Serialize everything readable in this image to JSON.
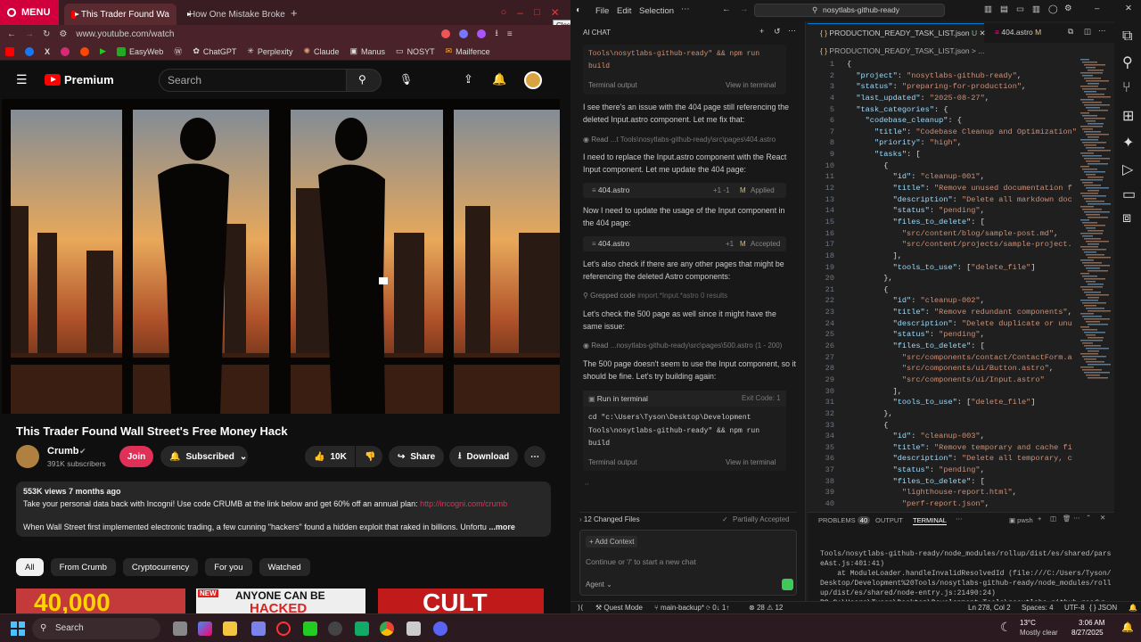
{
  "browser": {
    "menu_label": "MENU",
    "tabs": [
      {
        "label": "This Trader Found Wa"
      },
      {
        "label": "How One Mistake Broke C"
      }
    ],
    "close_tooltip": "Close",
    "url": "www.youtube.com/watch",
    "bookmarks": [
      {
        "label": "EasyWeb"
      },
      {
        "label": "ChatGPT"
      },
      {
        "label": "Perplexity"
      },
      {
        "label": "Claude"
      },
      {
        "label": "Manus"
      },
      {
        "label": "NOSYT"
      },
      {
        "label": "Mailfence"
      }
    ]
  },
  "youtube": {
    "logo": "Premium",
    "search_placeholder": "Search",
    "video_title": "This Trader Found Wall Street's Free Money Hack",
    "channel": "Crumb",
    "subscribers": "391K subscribers",
    "join_label": "Join",
    "subscribed_label": "Subscribed",
    "likes": "10K",
    "share_label": "Share",
    "download_label": "Download",
    "views_line": "553K views  7 months ago",
    "desc_line1": "Take your personal data back with Incogni! Use code CRUMB at the link below and get 60% off an annual plan: ",
    "desc_link": "http://incogni.com/crumb",
    "desc_line2": "When Wall Street first implemented electronic trading, a few cunning \"hackers\" found a hidden exploit that raked in billions. Unfortu",
    "more_label": "...more",
    "chips": [
      "All",
      "From Crumb",
      "Cryptocurrency",
      "For you",
      "Watched"
    ],
    "thumb1_text": "40,000",
    "thumb2_new": "NEW",
    "thumb2_text1": "ANYONE CAN BE",
    "thumb2_text2": "HACKED",
    "thumb3_text": "CULT"
  },
  "vscode": {
    "menu": [
      "File",
      "Edit",
      "Selection"
    ],
    "search_text": "nosytlabs-github-ready",
    "chat_title": "AI CHAT",
    "chat": {
      "cmd_top": "Tools\\nosytlabs-github-ready\" && npm run build",
      "terminal_output": "Terminal output",
      "view_in_terminal": "View in terminal",
      "msg1": "I see there's an issue with the 404 page still referencing the deleted Input.astro component. Let me fix that:",
      "read1": "Read",
      "read1_path": "...t Tools\\nosytlabs-github-ready\\src\\pages\\404.astro",
      "msg2": "I need to replace the Input.astro component with the React Input component. Let me update the 404 page:",
      "file1": "404.astro",
      "file1_diff": "+1 -1",
      "file1_status": "Applied",
      "msg3": "Now I need to update the usage of the Input component in the 404 page:",
      "file2": "404.astro",
      "file2_diff": "+1",
      "file2_status": "Accepted",
      "msg4": "Let's also check if there are any other pages that might be referencing the deleted Astro components:",
      "grep": "Grepped code",
      "grep_detail": "import.*Input.*astro  0 results",
      "msg5": "Let's check the 500 page as well since it might have the same issue:",
      "read2": "Read",
      "read2_path": "...nosytlabs-github-ready\\src\\pages\\500.astro (1 - 200)",
      "msg6": "The 500 page doesn't seem to use the Input component, so it should be fine. Let's try building again:",
      "run_label": "Run in terminal",
      "exit_code": "Exit Code: 1",
      "cmd": "cd \"c:\\Users\\Tyson\\Desktop\\Development Tools\\nosytlabs-github-ready\" && npm run build",
      "dots": "∙∙",
      "changed_files": "12 Changed Files",
      "partially": "Partially Accepted",
      "add_context": "Add Context",
      "input_placeholder": "Continue or '/' to start a new chat",
      "agent_label": "Agent"
    },
    "tabs": [
      {
        "label": "PRODUCTION_READY_TASK_LIST.json",
        "badge": "U"
      },
      {
        "label": "404.astro",
        "badge": "M"
      }
    ],
    "breadcrumb": "PRODUCTION_READY_TASK_LIST.json > ...",
    "code_lines": [
      [
        [
          "pu",
          "{"
        ]
      ],
      [
        [
          "pu",
          "  "
        ],
        [
          "k",
          "\"project\""
        ],
        [
          "pu",
          ": "
        ],
        [
          "s",
          "\"nosytlabs-github-ready\""
        ],
        [
          "pu",
          ","
        ]
      ],
      [
        [
          "pu",
          "  "
        ],
        [
          "k",
          "\"status\""
        ],
        [
          "pu",
          ": "
        ],
        [
          "s",
          "\"preparing-for-production\""
        ],
        [
          "pu",
          ","
        ]
      ],
      [
        [
          "pu",
          "  "
        ],
        [
          "k",
          "\"last_updated\""
        ],
        [
          "pu",
          ": "
        ],
        [
          "s",
          "\"2025-08-27\""
        ],
        [
          "pu",
          ","
        ]
      ],
      [
        [
          "pu",
          "  "
        ],
        [
          "k",
          "\"task_categories\""
        ],
        [
          "pu",
          ": {"
        ]
      ],
      [
        [
          "pu",
          "    "
        ],
        [
          "k",
          "\"codebase_cleanup\""
        ],
        [
          "pu",
          ": {"
        ]
      ],
      [
        [
          "pu",
          "      "
        ],
        [
          "k",
          "\"title\""
        ],
        [
          "pu",
          ": "
        ],
        [
          "s",
          "\"Codebase Cleanup and Optimization\""
        ]
      ],
      [
        [
          "pu",
          "      "
        ],
        [
          "k",
          "\"priority\""
        ],
        [
          "pu",
          ": "
        ],
        [
          "s",
          "\"high\""
        ],
        [
          "pu",
          ","
        ]
      ],
      [
        [
          "pu",
          "      "
        ],
        [
          "k",
          "\"tasks\""
        ],
        [
          "pu",
          ": ["
        ]
      ],
      [
        [
          "pu",
          "        {"
        ]
      ],
      [
        [
          "pu",
          "          "
        ],
        [
          "k",
          "\"id\""
        ],
        [
          "pu",
          ": "
        ],
        [
          "s",
          "\"cleanup-001\""
        ],
        [
          "pu",
          ","
        ]
      ],
      [
        [
          "pu",
          "          "
        ],
        [
          "k",
          "\"title\""
        ],
        [
          "pu",
          ": "
        ],
        [
          "s",
          "\"Remove unused documentation f"
        ]
      ],
      [
        [
          "pu",
          "          "
        ],
        [
          "k",
          "\"description\""
        ],
        [
          "pu",
          ": "
        ],
        [
          "s",
          "\"Delete all markdown doc"
        ]
      ],
      [
        [
          "pu",
          "          "
        ],
        [
          "k",
          "\"status\""
        ],
        [
          "pu",
          ": "
        ],
        [
          "s",
          "\"pending\""
        ],
        [
          "pu",
          ","
        ]
      ],
      [
        [
          "pu",
          "          "
        ],
        [
          "k",
          "\"files_to_delete\""
        ],
        [
          "pu",
          ": ["
        ]
      ],
      [
        [
          "pu",
          "            "
        ],
        [
          "s",
          "\"src/content/blog/sample-post.md\""
        ],
        [
          "pu",
          ","
        ]
      ],
      [
        [
          "pu",
          "            "
        ],
        [
          "s",
          "\"src/content/projects/sample-project."
        ]
      ],
      [
        [
          "pu",
          "          ],"
        ]
      ],
      [
        [
          "pu",
          "          "
        ],
        [
          "k",
          "\"tools_to_use\""
        ],
        [
          "pu",
          ": ["
        ],
        [
          "s",
          "\"delete_file\""
        ],
        [
          "pu",
          "]"
        ]
      ],
      [
        [
          "pu",
          "        },"
        ]
      ],
      [
        [
          "pu",
          "        {"
        ]
      ],
      [
        [
          "pu",
          "          "
        ],
        [
          "k",
          "\"id\""
        ],
        [
          "pu",
          ": "
        ],
        [
          "s",
          "\"cleanup-002\""
        ],
        [
          "pu",
          ","
        ]
      ],
      [
        [
          "pu",
          "          "
        ],
        [
          "k",
          "\"title\""
        ],
        [
          "pu",
          ": "
        ],
        [
          "s",
          "\"Remove redundant components\""
        ],
        [
          "pu",
          ","
        ]
      ],
      [
        [
          "pu",
          "          "
        ],
        [
          "k",
          "\"description\""
        ],
        [
          "pu",
          ": "
        ],
        [
          "s",
          "\"Delete duplicate or unu"
        ]
      ],
      [
        [
          "pu",
          "          "
        ],
        [
          "k",
          "\"status\""
        ],
        [
          "pu",
          ": "
        ],
        [
          "s",
          "\"pending\""
        ],
        [
          "pu",
          ","
        ]
      ],
      [
        [
          "pu",
          "          "
        ],
        [
          "k",
          "\"files_to_delete\""
        ],
        [
          "pu",
          ": ["
        ]
      ],
      [
        [
          "pu",
          "            "
        ],
        [
          "s",
          "\"src/components/contact/ContactForm.a"
        ]
      ],
      [
        [
          "pu",
          "            "
        ],
        [
          "s",
          "\"src/components/ui/Button.astro\""
        ],
        [
          "pu",
          ","
        ]
      ],
      [
        [
          "pu",
          "            "
        ],
        [
          "s",
          "\"src/components/ui/Input.astro\""
        ]
      ],
      [
        [
          "pu",
          "          ],"
        ]
      ],
      [
        [
          "pu",
          "          "
        ],
        [
          "k",
          "\"tools_to_use\""
        ],
        [
          "pu",
          ": ["
        ],
        [
          "s",
          "\"delete_file\""
        ],
        [
          "pu",
          "]"
        ]
      ],
      [
        [
          "pu",
          "        },"
        ]
      ],
      [
        [
          "pu",
          "        {"
        ]
      ],
      [
        [
          "pu",
          "          "
        ],
        [
          "k",
          "\"id\""
        ],
        [
          "pu",
          ": "
        ],
        [
          "s",
          "\"cleanup-003\""
        ],
        [
          "pu",
          ","
        ]
      ],
      [
        [
          "pu",
          "          "
        ],
        [
          "k",
          "\"title\""
        ],
        [
          "pu",
          ": "
        ],
        [
          "s",
          "\"Remove temporary and cache fi"
        ]
      ],
      [
        [
          "pu",
          "          "
        ],
        [
          "k",
          "\"description\""
        ],
        [
          "pu",
          ": "
        ],
        [
          "s",
          "\"Delete all temporary, c"
        ]
      ],
      [
        [
          "pu",
          "          "
        ],
        [
          "k",
          "\"status\""
        ],
        [
          "pu",
          ": "
        ],
        [
          "s",
          "\"pending\""
        ],
        [
          "pu",
          ","
        ]
      ],
      [
        [
          "pu",
          "          "
        ],
        [
          "k",
          "\"files_to_delete\""
        ],
        [
          "pu",
          ": ["
        ]
      ],
      [
        [
          "pu",
          "            "
        ],
        [
          "s",
          "\"lighthouse-report.html\""
        ],
        [
          "pu",
          ","
        ]
      ],
      [
        [
          "pu",
          "            "
        ],
        [
          "s",
          "\"perf-report.json\""
        ],
        [
          "pu",
          ","
        ]
      ]
    ],
    "panel": {
      "problems": "PROBLEMS",
      "problems_count": "40",
      "output": "OUTPUT",
      "terminal": "TERMINAL",
      "shell": "pwsh"
    },
    "terminal_lines": [
      "Tools/nosytlabs-github-ready/node_modules/rollup/dist/es/shared/pars",
      "eAst.js:401:41)",
      "    at ModuleLoader.handleInvalidResolvedId (file:///C:/Users/Tyson/",
      "Desktop/Development%20Tools/nosytlabs-github-ready/node_modules/roll",
      "up/dist/es/shared/node-entry.js:21490:24)",
      "PS C:\\Users\\Tyson\\Desktop\\Development Tools\\nosytlabs-github-ready>"
    ],
    "status": {
      "mode": "Quest Mode",
      "branch": "main-backup*",
      "sync": "0↓ 1↑",
      "errors": "28",
      "warnings": "12",
      "position": "Ln 278, Col 2",
      "spaces": "Spaces: 4",
      "encoding": "UTF-8",
      "language": "JSON"
    }
  },
  "taskbar": {
    "search": "Search",
    "weather_temp": "13°C",
    "weather_desc": "Mostly clear",
    "time": "3:06 AM",
    "date": "8/27/2025"
  }
}
